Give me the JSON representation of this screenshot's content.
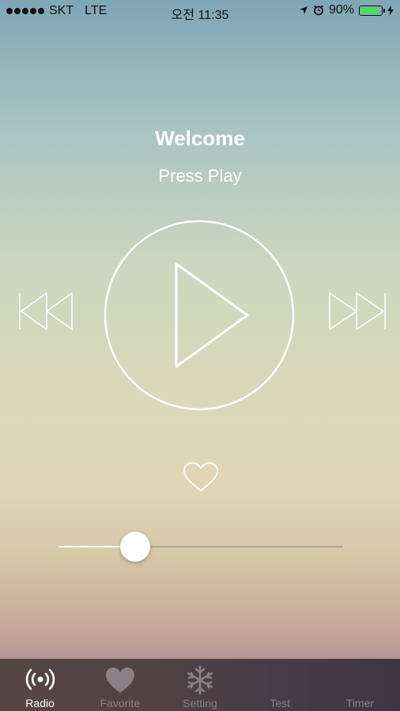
{
  "status_bar": {
    "carrier": "SKT",
    "network": "LTE",
    "time": "오전 11:35",
    "battery_percent_label": "90%",
    "battery_level": 0.9,
    "signal_bars": 5
  },
  "player": {
    "title": "Welcome",
    "subtitle": "Press Play",
    "volume_level": 0.27
  },
  "colors": {
    "accent": "#ffffff",
    "battery": "#4cd964",
    "tab_inactive": "#8a8085",
    "tab_active": "#ffffff"
  },
  "tabs": [
    {
      "label": "Radio",
      "icon": "radio-waves-icon",
      "active": true
    },
    {
      "label": "Favorite",
      "icon": "heart-icon",
      "active": false
    },
    {
      "label": "Setting",
      "icon": "snowflake-settings-icon",
      "active": false
    },
    {
      "label": "Test",
      "icon": "",
      "active": false
    },
    {
      "label": "Timer",
      "icon": "",
      "active": false
    }
  ]
}
